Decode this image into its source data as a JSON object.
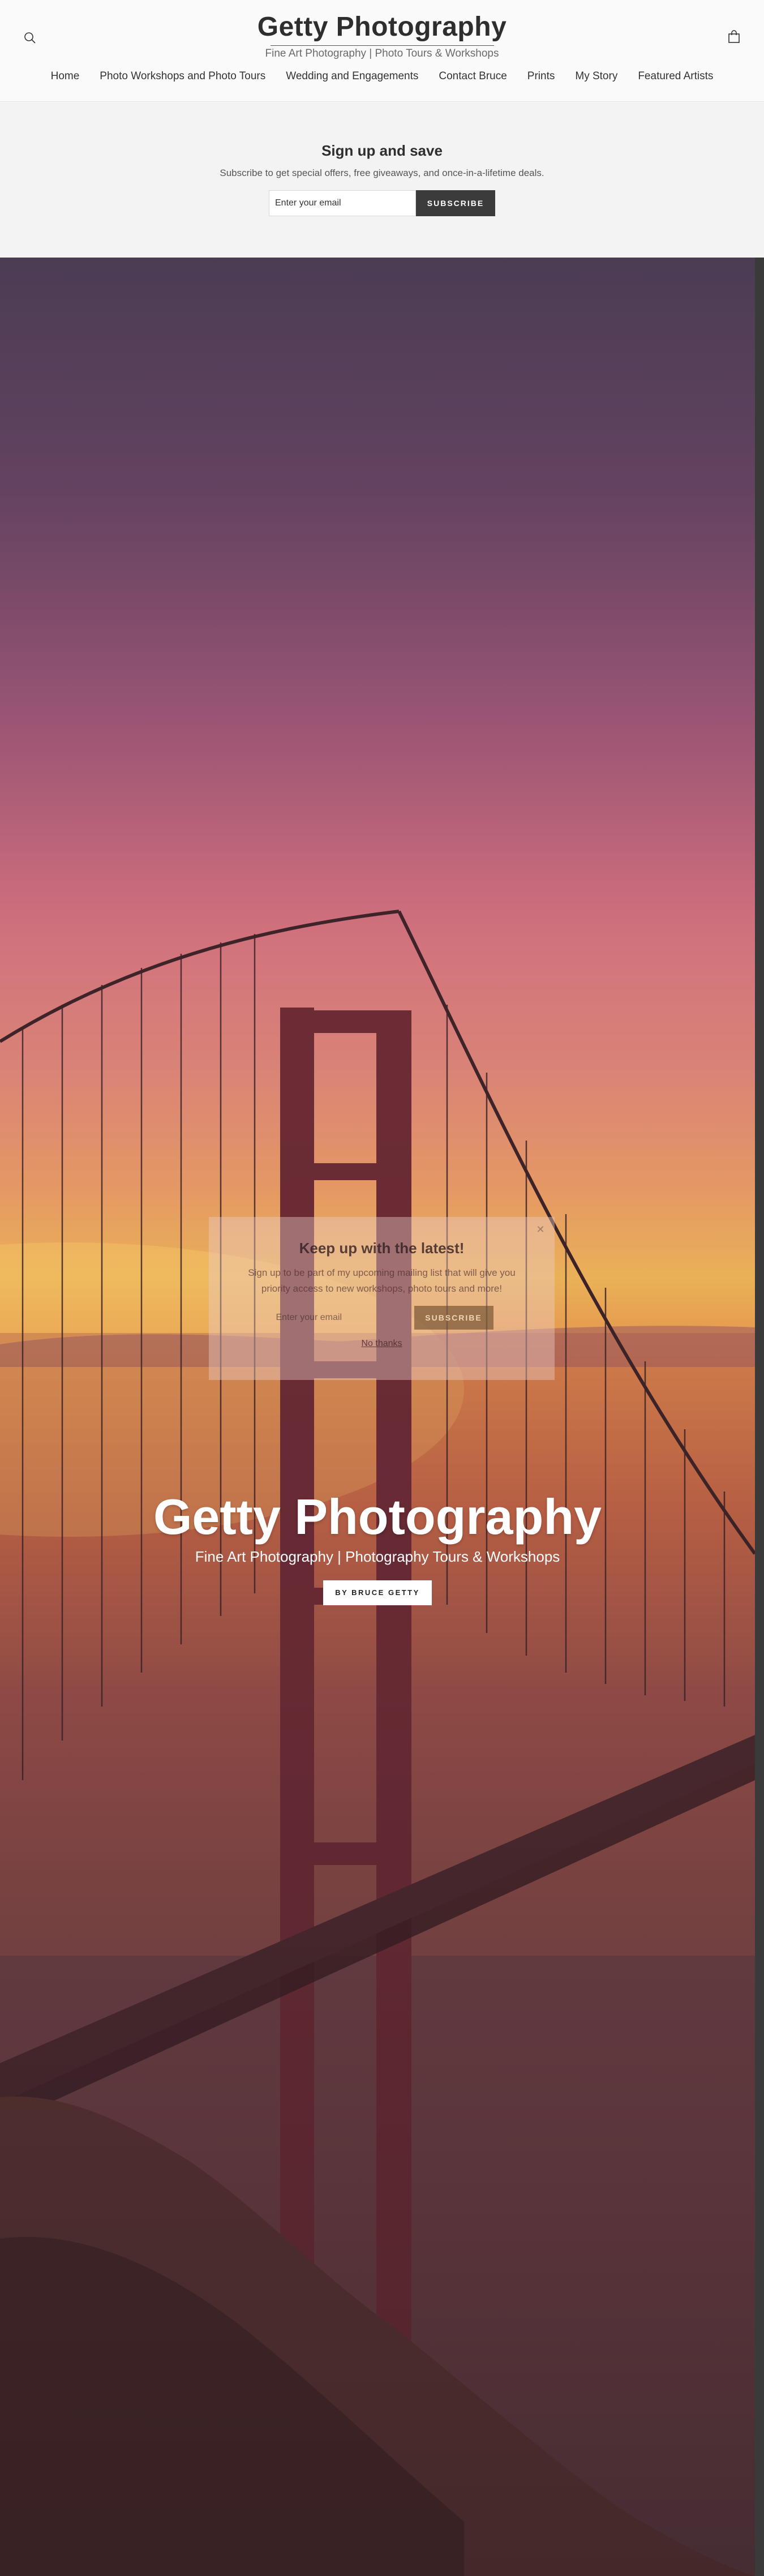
{
  "header": {
    "site_title": "Getty Photography",
    "site_tagline": "Fine Art Photography | Photo Tours & Workshops",
    "search_icon": "search-icon",
    "cart_icon": "shopping-bag-icon",
    "nav": [
      {
        "label": "Home"
      },
      {
        "label": "Photo Workshops and Photo Tours"
      },
      {
        "label": "Wedding and Engagements"
      },
      {
        "label": "Contact Bruce"
      },
      {
        "label": "Prints"
      },
      {
        "label": "My Story"
      },
      {
        "label": "Featured Artists"
      }
    ]
  },
  "signup": {
    "title": "Sign up and save",
    "text": "Subscribe to get special offers, free giveaways, and once-in-a-lifetime deals.",
    "email_placeholder": "Enter your email",
    "button_label": "SUBSCRIBE"
  },
  "popup": {
    "title": "Keep up with the latest!",
    "text": "Sign up to be part of my upcoming mailing list that will give you priority access to new workshops, photo tours and more!",
    "email_placeholder": "Enter your email",
    "button_label": "SUBSCRIBE",
    "dismiss_label": "No thanks",
    "close_icon": "close-icon"
  },
  "hero": {
    "title": "Getty Photography",
    "subtitle": "Fine Art Photography | Photography Tours & Workshops",
    "button_label": "BY BRUCE GETTY",
    "image_subject": "golden-gate-bridge-sunset"
  },
  "colors": {
    "header_bg": "#fafafa",
    "signup_bg": "#f3f3f3",
    "button_dark": "#3b3b3b",
    "text_dark": "#2e2e2e"
  }
}
